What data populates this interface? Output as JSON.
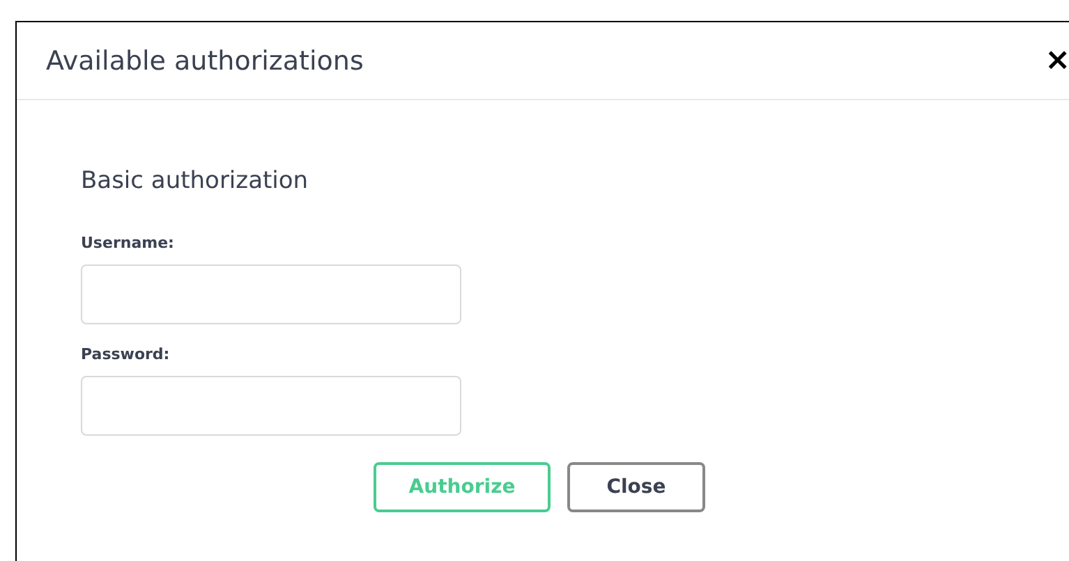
{
  "dialog": {
    "title": "Available authorizations",
    "close_glyph": "×"
  },
  "section": {
    "heading": "Basic authorization",
    "fields": [
      {
        "label": "Username:"
      },
      {
        "label": "Password:"
      }
    ]
  },
  "buttons": [
    {
      "label": "Authorize",
      "kind": "primary"
    },
    {
      "label": "Close",
      "kind": "secondary"
    }
  ]
}
